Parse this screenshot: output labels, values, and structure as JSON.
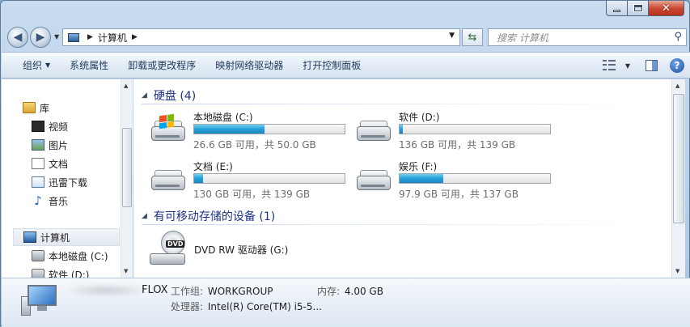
{
  "nav": {
    "path_root": "计算机",
    "search_placeholder": "搜索 计算机"
  },
  "toolbar": {
    "organize": "组织",
    "system_properties": "系统属性",
    "uninstall": "卸载或更改程序",
    "map_drive": "映射网络驱动器",
    "control_panel": "打开控制面板"
  },
  "sidebar": {
    "items": [
      {
        "label": "库",
        "icon": "library-icon"
      },
      {
        "label": "视频",
        "icon": "video-icon"
      },
      {
        "label": "图片",
        "icon": "pictures-icon"
      },
      {
        "label": "文档",
        "icon": "documents-icon"
      },
      {
        "label": "迅雷下载",
        "icon": "download-icon"
      },
      {
        "label": "音乐",
        "icon": "music-icon"
      },
      {
        "label": "计算机",
        "icon": "computer-icon"
      },
      {
        "label": "本地磁盘 (C:)",
        "icon": "drive-icon"
      },
      {
        "label": "软件 (D:)",
        "icon": "drive-icon"
      }
    ]
  },
  "content": {
    "hdd_group": "硬盘 (4)",
    "removable_group": "有可移动存储的设备 (1)",
    "drives": [
      {
        "name": "本地磁盘 (C:)",
        "free": "26.6 GB 可用，共 50.0 GB",
        "used_fraction": 0.47,
        "system": true
      },
      {
        "name": "软件 (D:)",
        "free": "136 GB 可用，共 139 GB",
        "used_fraction": 0.02,
        "system": false
      },
      {
        "name": "文档 (E:)",
        "free": "130 GB 可用，共 139 GB",
        "used_fraction": 0.06,
        "system": false
      },
      {
        "name": "娱乐 (F:)",
        "free": "97.9 GB 可用，共 137 GB",
        "used_fraction": 0.29,
        "system": false
      }
    ],
    "dvd": {
      "name": "DVD RW 驱动器 (G:)",
      "label": "DVD"
    }
  },
  "details": {
    "computer_name": "FLOX",
    "workgroup_label": "工作组:",
    "workgroup": "WORKGROUP",
    "memory_label": "内存:",
    "memory": "4.00 GB",
    "cpu_label": "处理器:",
    "cpu": "Intel(R) Core(TM) i5-5..."
  },
  "colors": {
    "usage_bar": "#26a0da",
    "group_header": "#1e3287"
  }
}
